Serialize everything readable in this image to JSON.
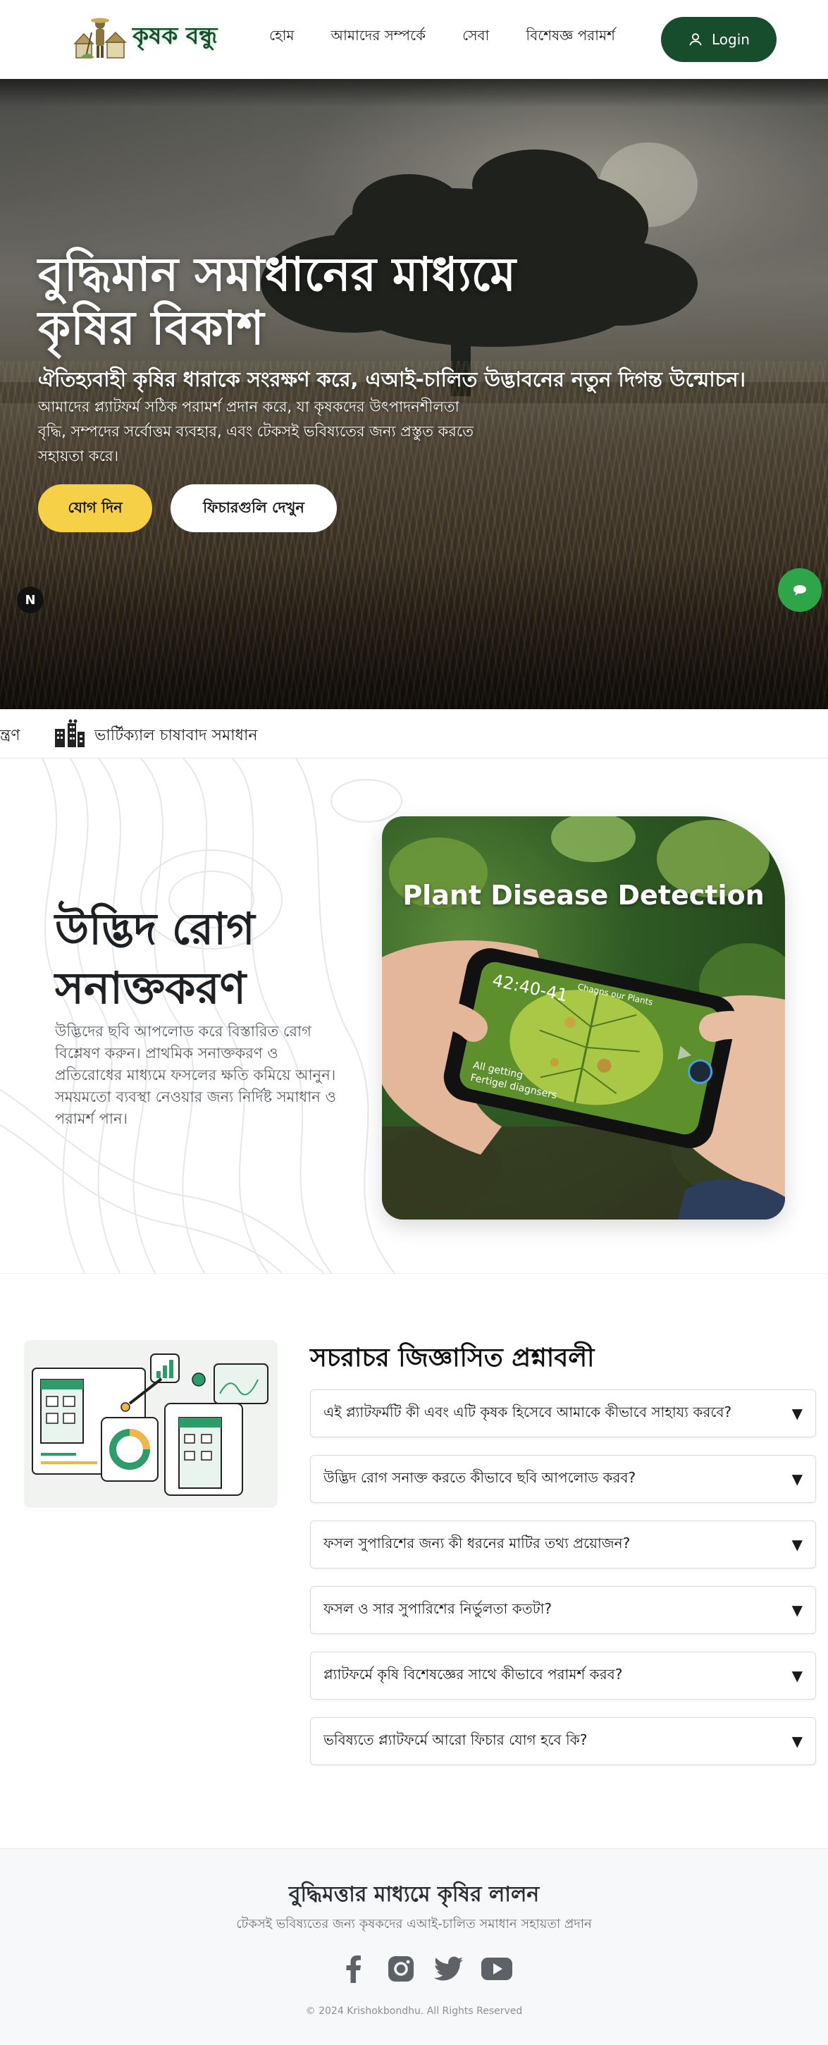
{
  "brand": {
    "name": "কৃষক বন্ধু"
  },
  "nav": {
    "links": [
      "হোম",
      "আমাদের সম্পর্কে",
      "সেবা",
      "বিশেষজ্ঞ পরামর্শ"
    ],
    "login_label": "Login"
  },
  "hero": {
    "title_line1": "বুদ্ধিমান সমাধানের মাধ্যমে",
    "title_line2": "কৃষির বিকাশ",
    "subtitle": "ঐতিহ্যবাহী কৃষির ধারাকে সংরক্ষণ করে, এআই-চালিত উদ্ভাবনের নতুন দিগন্ত উন্মোচন।",
    "description": "আমাদের প্ল্যাটফর্ম সঠিক পরামর্শ প্রদান করে, যা কৃষকদের উৎপাদনশীলতা বৃদ্ধি, সম্পদের সর্বোত্তম ব্যবহার, এবং টেকসই ভবিষ্যতের জন্য প্রস্তুত করতে সহায়তা করে।",
    "join_label": "যোগ দিন",
    "features_label": "ফিচারগুলি দেখুন",
    "badge": "N"
  },
  "ticker": {
    "left_fragment": "ন্ত্রণ",
    "item": "ভার্টিক্যাল চাষাবাদ সমাধান"
  },
  "disease": {
    "title_line1": "উদ্ভিদ রোগ",
    "title_line2": "সনাক্তকরণ",
    "description": "উদ্ভিদের ছবি আপলোড করে বিস্তারিত রোগ বিশ্লেষণ করুন। প্রাথমিক সনাক্তকরণ ও প্রতিরোধের মাধ্যমে ফসলের ক্ষতি কমিয়ে আনুন। সময়মতো ব্যবস্থা নেওয়ার জন্য নির্দিষ্ট সমাধান ও পরামর্শ পান।",
    "image_title": "Plant Disease Detection",
    "phone_time": "42:40-41",
    "phone_header": "Chagns our Plants",
    "phone_caption_line1": "All getting",
    "phone_caption_line2": "Fertigel diagnsers"
  },
  "faq": {
    "title": "সচরাচর জিজ্ঞাসিত প্রশ্নাবলী",
    "items": [
      "এই প্ল্যাটফর্মটি কী এবং এটি কৃষক হিসেবে আমাকে কীভাবে সাহায্য করবে?",
      "উদ্ভিদ রোগ সনাক্ত করতে কীভাবে ছবি আপলোড করব?",
      "ফসল সুপারিশের জন্য কী ধরনের মাটির তথ্য প্রয়োজন?",
      "ফসল ও সার সুপারিশের নির্ভুলতা কতটা?",
      "প্ল্যাটফর্মে কৃষি বিশেষজ্ঞের সাথে কীভাবে পরামর্শ করব?",
      "ভবিষ্যতে প্ল্যাটফর্মে আরো ফিচার যোগ হবে কি?"
    ],
    "arrow": "▼"
  },
  "footer": {
    "title": "বুদ্ধিমত্তার মাধ্যমে কৃষির লালন",
    "subtitle": "টেকসই ভবিষ্যতের জন্য কৃষকদের এআই-চালিত সমাধান সহায়তা প্রদান",
    "socials": [
      "facebook-icon",
      "instagram-icon",
      "twitter-icon",
      "youtube-icon"
    ],
    "copyright": "© 2024 Krishokbondhu. All Rights Reserved"
  },
  "colors": {
    "brand_green": "#174d2c",
    "accent_yellow": "#f6d046",
    "chat_green": "#2fa54a"
  }
}
